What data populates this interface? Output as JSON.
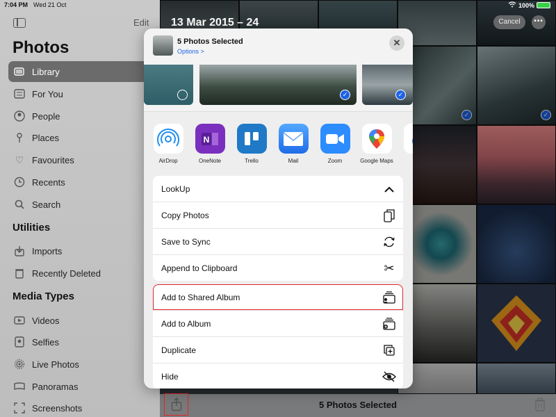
{
  "status_bar": {
    "time": "7:04 PM",
    "date": "Wed 21 Oct",
    "battery": "100%"
  },
  "sidebar": {
    "edit_label": "Edit",
    "title": "Photos",
    "items": [
      {
        "label": "Library",
        "icon": "photo-library-icon",
        "active": true
      },
      {
        "label": "For You",
        "icon": "for-you-icon"
      },
      {
        "label": "People",
        "icon": "person-icon"
      },
      {
        "label": "Places",
        "icon": "pin-icon"
      },
      {
        "label": "Favourites",
        "icon": "heart-icon"
      },
      {
        "label": "Recents",
        "icon": "clock-icon"
      },
      {
        "label": "Search",
        "icon": "search-icon"
      }
    ],
    "utilities": {
      "heading": "Utilities",
      "items": [
        {
          "label": "Imports",
          "icon": "import-icon"
        },
        {
          "label": "Recently Deleted",
          "icon": "trash-icon"
        }
      ]
    },
    "media_types": {
      "heading": "Media Types",
      "items": [
        {
          "label": "Videos",
          "icon": "video-icon"
        },
        {
          "label": "Selfies",
          "icon": "selfie-icon"
        },
        {
          "label": "Live Photos",
          "icon": "live-photo-icon"
        },
        {
          "label": "Panoramas",
          "icon": "panorama-icon"
        },
        {
          "label": "Screenshots",
          "icon": "screenshot-icon"
        }
      ]
    }
  },
  "header": {
    "date_range": "13 Mar 2015 – 24",
    "cancel_label": "Cancel",
    "more_label": "•••"
  },
  "toolbar": {
    "title": "5 Photos Selected"
  },
  "share_sheet": {
    "title": "5 Photos Selected",
    "options_label": "Options >",
    "close_label": "✕",
    "apps": [
      {
        "label": "AirDrop",
        "icon": "airdrop-icon",
        "color": "#ffffff"
      },
      {
        "label": "OneNote",
        "icon": "onenote-icon",
        "color": "#7b2fbe"
      },
      {
        "label": "Trello",
        "icon": "trello-icon",
        "color": "#1f79c7"
      },
      {
        "label": "Mail",
        "icon": "mail-icon",
        "color": "#2f8df5"
      },
      {
        "label": "Zoom",
        "icon": "zoom-icon",
        "color": "#2d8cff"
      },
      {
        "label": "Google Maps",
        "icon": "google-maps-icon",
        "color": "#ffffff"
      },
      {
        "label": "On",
        "icon": "partial-app-icon",
        "color": "#ffffff"
      }
    ],
    "actions": [
      {
        "label": "LookUp",
        "icon": "chevron-up-icon"
      },
      {
        "label": "Copy Photos",
        "icon": "copy-icon"
      },
      {
        "label": "Save to Sync",
        "icon": "sync-icon"
      },
      {
        "label": "Append to Clipboard",
        "icon": "scissors-icon"
      },
      {
        "label": "Add to Shared Album",
        "icon": "shared-album-icon",
        "highlighted": true
      },
      {
        "label": "Add to Album",
        "icon": "add-album-icon"
      },
      {
        "label": "Duplicate",
        "icon": "duplicate-icon"
      },
      {
        "label": "Hide",
        "icon": "hide-icon"
      }
    ]
  },
  "colors": {
    "accent": "#1e63e6",
    "highlight": "#e0262b"
  }
}
